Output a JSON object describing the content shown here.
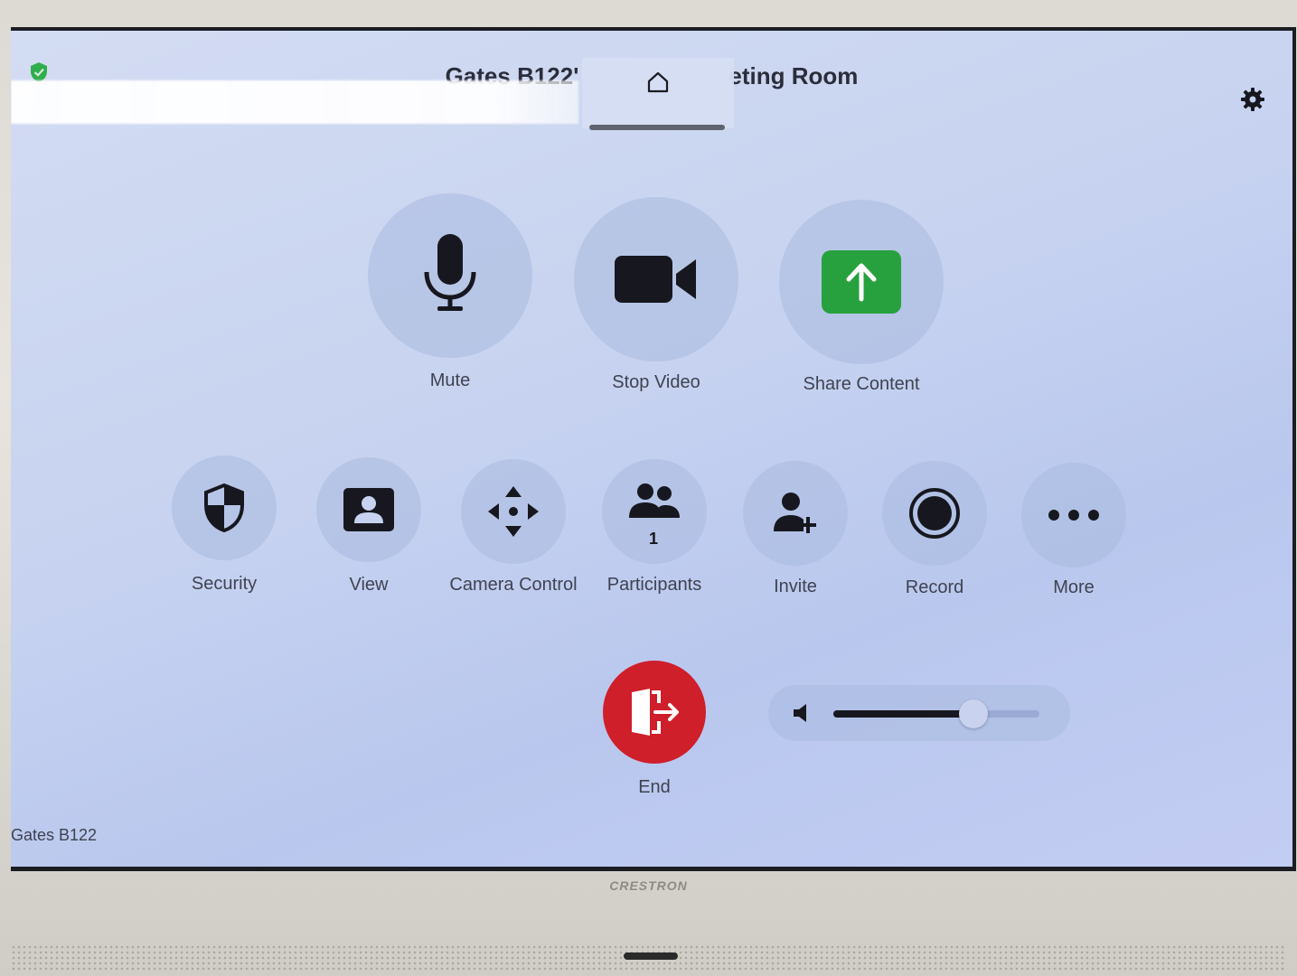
{
  "header": {
    "title_left": "Gates B122'",
    "title_right": "eting Room"
  },
  "controls": {
    "mute_label": "Mute",
    "stop_video_label": "Stop Video",
    "share_content_label": "Share Content"
  },
  "actions": {
    "security_label": "Security",
    "view_label": "View",
    "camera_control_label": "Camera Control",
    "participants_label": "Participants",
    "participants_count": "1",
    "invite_label": "Invite",
    "record_label": "Record",
    "more_label": "More"
  },
  "end_label": "End",
  "volume": {
    "level": 0.68
  },
  "footer": {
    "room_name": "Gates B122"
  },
  "device": {
    "brand": "CRESTRON"
  },
  "colors": {
    "share_green": "#27a13e",
    "end_red": "#cf1f2a",
    "secure_green": "#2fae4d",
    "icon_dark": "#17181f"
  },
  "icons": {
    "secure": "shield-check-icon",
    "home": "home-icon",
    "settings": "gear-icon",
    "mute": "microphone-icon",
    "video": "video-camera-icon",
    "share": "share-arrow-up-icon",
    "security": "shield-icon",
    "view": "person-card-icon",
    "camera_control": "move-arrows-icon",
    "participants": "people-icon",
    "invite": "person-add-icon",
    "record": "record-icon",
    "more": "ellipsis-icon",
    "end": "exit-door-icon",
    "volume": "speaker-icon"
  }
}
